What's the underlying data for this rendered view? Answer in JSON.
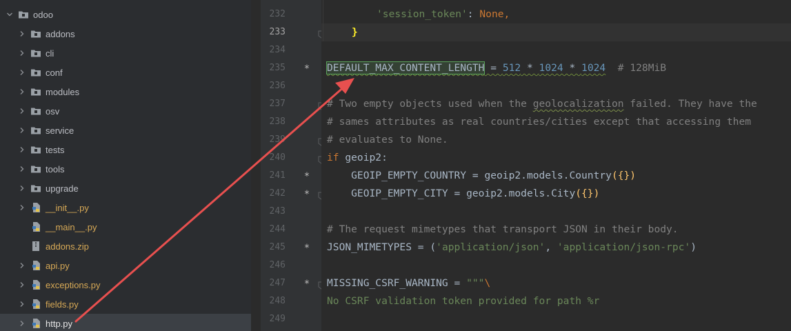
{
  "tree": {
    "root": {
      "label": "odoo"
    },
    "items": [
      {
        "label": "addons",
        "type": "folder"
      },
      {
        "label": "cli",
        "type": "folder"
      },
      {
        "label": "conf",
        "type": "folder"
      },
      {
        "label": "modules",
        "type": "folder"
      },
      {
        "label": "osv",
        "type": "folder"
      },
      {
        "label": "service",
        "type": "folder"
      },
      {
        "label": "tests",
        "type": "folder"
      },
      {
        "label": "tools",
        "type": "folder"
      },
      {
        "label": "upgrade",
        "type": "folder"
      },
      {
        "label": "__init__.py",
        "type": "python"
      },
      {
        "label": "__main__.py",
        "type": "python"
      },
      {
        "label": "addons.zip",
        "type": "zip"
      },
      {
        "label": "api.py",
        "type": "python"
      },
      {
        "label": "exceptions.py",
        "type": "python"
      },
      {
        "label": "fields.py",
        "type": "python"
      },
      {
        "label": "http.py",
        "type": "python",
        "selected": true
      }
    ]
  },
  "gutter": {
    "lines": [
      "232",
      "233",
      "234",
      "235",
      "236",
      "237",
      "238",
      "239",
      "240",
      "241",
      "242",
      "243",
      "244",
      "245",
      "246",
      "247",
      "248",
      "249"
    ],
    "current": "233",
    "change_marker": "*"
  },
  "code": {
    "l232_key": "'session_token'",
    "l232_colon": ": ",
    "l232_val": "None",
    "l232_comma": ",",
    "l233_brace": "}",
    "l235_name": "DEFAULT_MAX_CONTENT_LENGTH",
    "l235_eq": " = ",
    "l235_n1": "512",
    "l235_op1": " * ",
    "l235_n2": "1024",
    "l235_op2": " * ",
    "l235_n3": "1024",
    "l235_cmt": "  # 128MiB",
    "l237_a": "# Two empty objects used when the ",
    "l237_b": "geolocalization",
    "l237_c": " failed. They have the",
    "l238": "# sames attributes as real countries/cities except that accessing them",
    "l239": "# evaluates to None.",
    "l240_kw": "if",
    "l240_rest": " geoip2:",
    "l241_a": "    GEOIP_EMPTY_COUNTRY = geoip2.models.Country",
    "l241_b": "({})",
    "l242_a": "    GEOIP_EMPTY_CITY = geoip2.models.City",
    "l242_b": "({})",
    "l244": "# The request mimetypes that transport JSON in their body.",
    "l245_a": "JSON_MIMETYPES = (",
    "l245_s1": "'application/json'",
    "l245_c": ", ",
    "l245_s2": "'application/json-rpc'",
    "l245_d": ")",
    "l247_a": "MISSING_CSRF_WARNING = ",
    "l247_s": "\"\"\"",
    "l247_esc": "\\",
    "l248": "No CSRF validation token provided for path %r"
  },
  "colors": {
    "keyword": "#cc7832",
    "string": "#6a8759",
    "number": "#6897bb",
    "comment": "#808080",
    "annotation_arrow": "#e8504f"
  }
}
